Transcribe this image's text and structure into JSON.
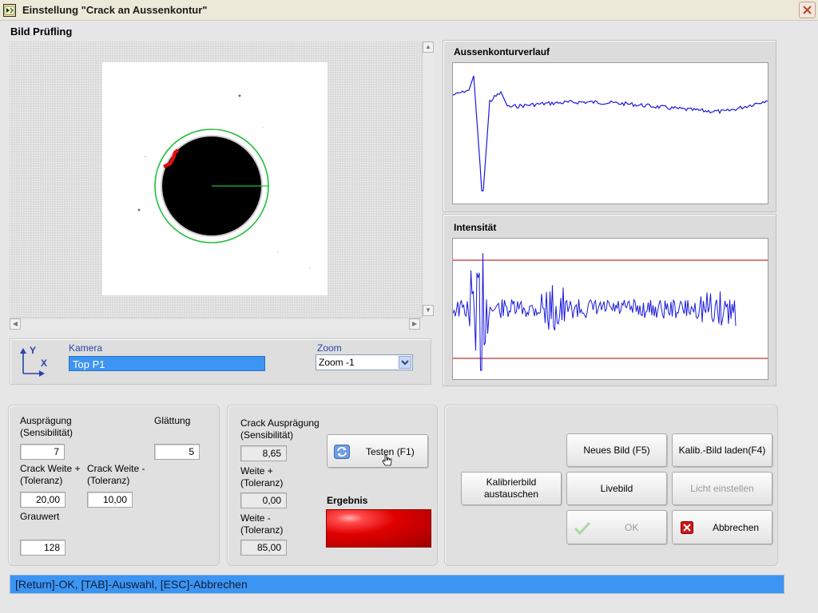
{
  "window": {
    "title": "Einstellung \"Crack  an Aussenkontur\"",
    "close_symbol": "✕"
  },
  "image_section": {
    "title": "Bild Prüfling",
    "axis_y": "Y",
    "axis_x": "X",
    "camera_label": "Kamera",
    "camera_value": "Top P1",
    "zoom_label": "Zoom",
    "zoom_value": "Zoom -1"
  },
  "graphs": {
    "contour_title": "Aussenkonturverlauf",
    "intensity_title": "Intensität"
  },
  "settings": {
    "auspraegung_label": "Ausprägung",
    "auspraegung_sub": "(Sensibilität)",
    "auspraegung_value": "7",
    "glaettung_label": "Glättung",
    "glaettung_value": "5",
    "crack_weite_plus_label": "Crack Weite +",
    "crack_weite_plus_sub": "(Toleranz)",
    "crack_weite_plus_value": "20,00",
    "crack_weite_minus_label": "Crack Weite -",
    "crack_weite_minus_sub": "(Toleranz)",
    "crack_weite_minus_value": "10,00",
    "grauwert_label": "Grauwert",
    "grauwert_value": "128"
  },
  "test": {
    "crack_auspraegung_label": "Crack Ausprägung",
    "crack_auspraegung_sub": "(Sensibilität)",
    "crack_auspraegung_value": "8,65",
    "weite_plus_label": "Weite +",
    "weite_plus_sub": "(Toleranz)",
    "weite_plus_value": "0,00",
    "weite_minus_label": "Weite -",
    "weite_minus_sub": "(Toleranz)",
    "weite_minus_value": "85,00",
    "test_button": "Testen (F1)",
    "result_label": "Ergebnis",
    "result_color": "#d00000"
  },
  "actions": {
    "neues_bild": "Neues Bild (F5)",
    "kalib_bild_laden": "Kalib.-Bild laden(F4)",
    "kalibrierbild_line1": "Kalibrierbild",
    "kalibrierbild_line2": "austauschen",
    "livebild": "Livebild",
    "licht_einstellen": "Licht einstellen",
    "ok": "OK",
    "abbrechen": "Abbrechen"
  },
  "status": {
    "text": "[Return]-OK, [TAB]-Auswahl, [ESC]-Abbrechen"
  },
  "colors": {
    "accent_blue": "#3d95f3",
    "plot_line": "#1a1adc",
    "limit_line": "#b00000",
    "contour_circle": "#1fbf3a",
    "crack_mark": "#e01010"
  }
}
